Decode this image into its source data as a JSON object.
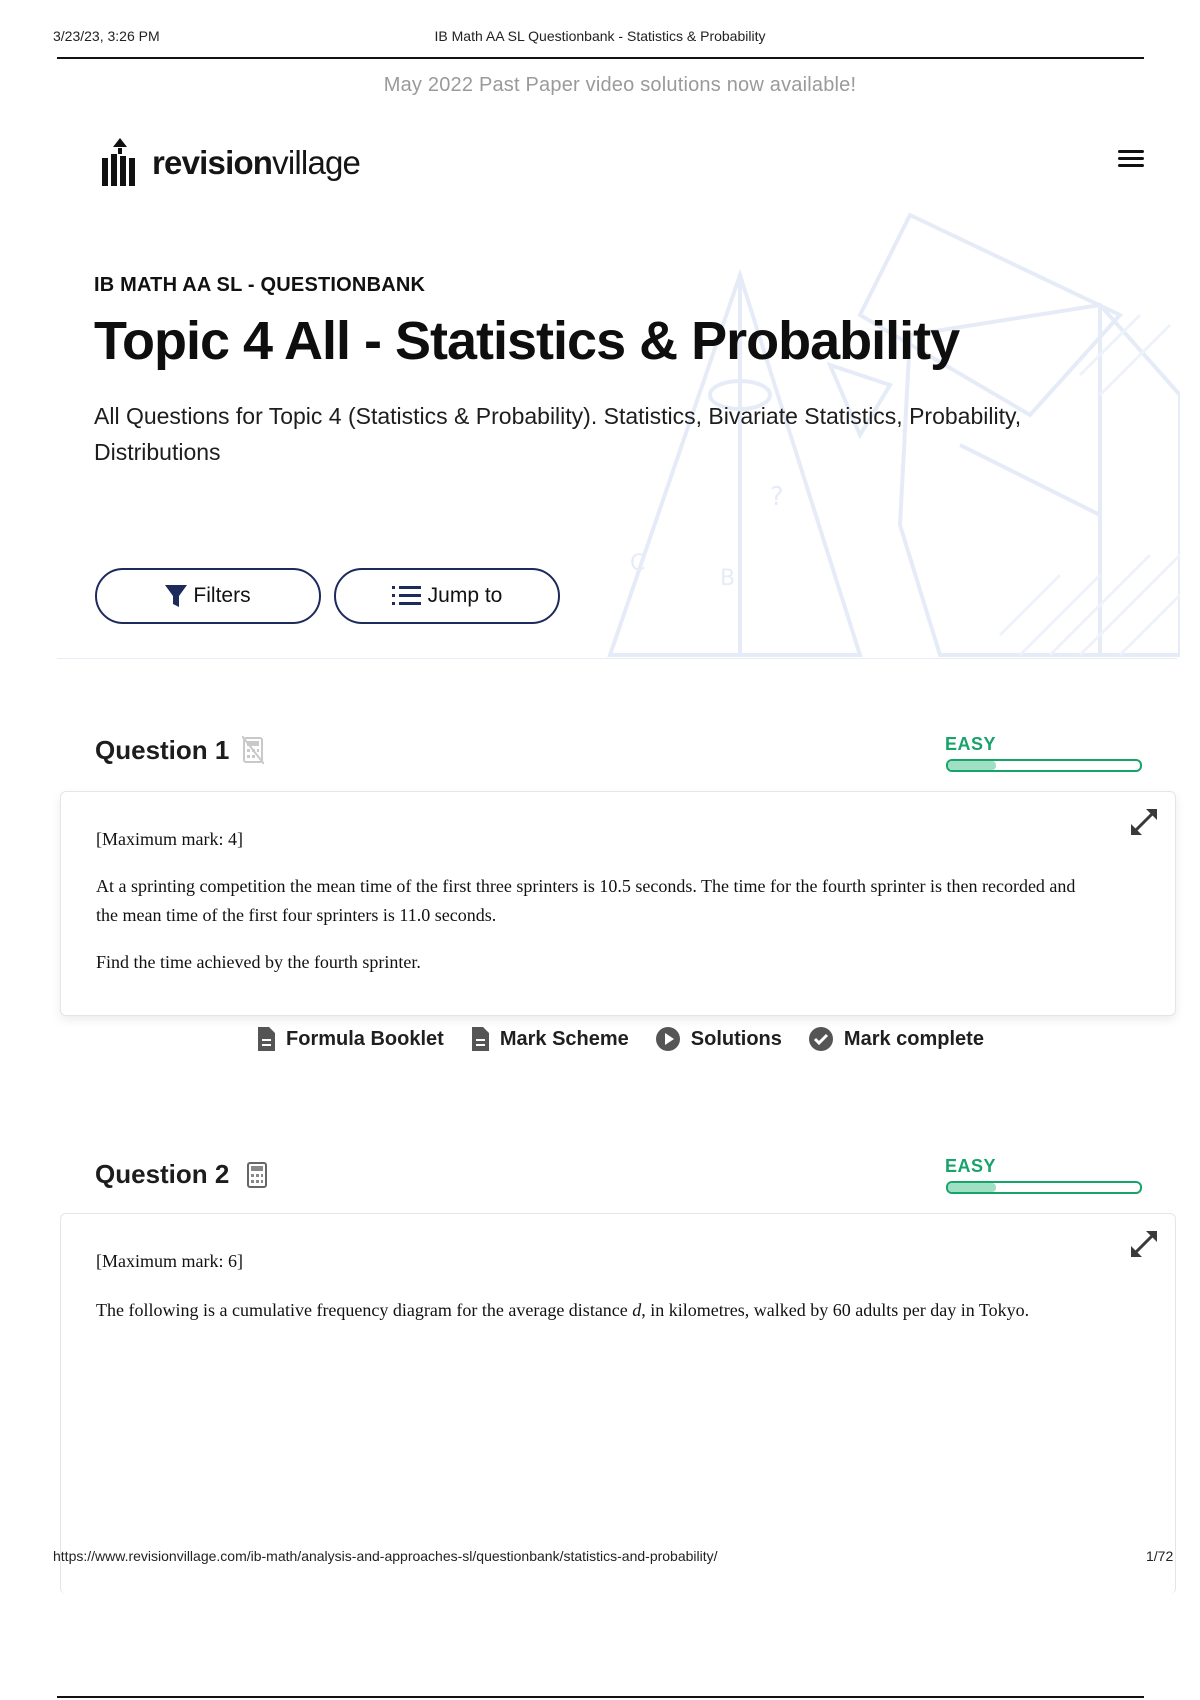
{
  "print_header": {
    "datetime": "3/23/23, 3:26 PM",
    "doc_title": "IB Math AA SL Questionbank - Statistics & Probability"
  },
  "banner": {
    "text": "May 2022 Past Paper video solutions now available!"
  },
  "logo": {
    "bold": "revision",
    "light": "village"
  },
  "hero": {
    "eyebrow": "IB MATH AA SL - QUESTIONBANK",
    "title": "Topic 4 All - Statistics & Probability",
    "description": "All Questions for Topic 4 (Statistics & Probability). Statistics, Bivariate Statistics, Probability, Distributions",
    "filters_label": "Filters",
    "jump_label": "Jump to"
  },
  "questions": [
    {
      "title": "Question 1",
      "difficulty": "EASY",
      "difficulty_level": 0.25,
      "calculator": "no-calculator",
      "max_mark": "[Maximum mark: 4]",
      "paragraphs": [
        "At a sprinting competition the mean time of the first three sprinters is 10.5 seconds. The time for the fourth sprinter is then recorded and the mean time of the first four sprinters is 11.0 seconds.",
        "Find the time achieved by the fourth sprinter."
      ]
    },
    {
      "title": "Question 2",
      "difficulty": "EASY",
      "difficulty_level": 0.25,
      "calculator": "calculator",
      "max_mark": "[Maximum mark: 6]",
      "paragraph_before": "The following is a cumulative frequency diagram for the average distance ",
      "paragraph_var": "d",
      "paragraph_after": ", in kilometres, walked by 60 adults per day in Tokyo."
    }
  ],
  "actions": {
    "formula_booklet": "Formula Booklet",
    "mark_scheme": "Mark Scheme",
    "solutions": "Solutions",
    "mark_complete": "Mark complete"
  },
  "print_footer": {
    "url": "https://www.revisionvillage.com/ib-math/analysis-and-approaches-sl/questionbank/statistics-and-probability/",
    "page": "1/72"
  },
  "colors": {
    "accent_navy": "#1d2a5c",
    "easy_green": "#18a36a",
    "banner_gray": "#9a9a9a"
  }
}
